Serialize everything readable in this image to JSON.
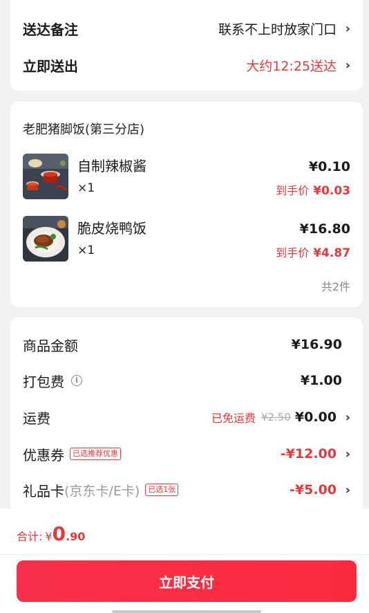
{
  "delivery": {
    "note_label": "送达备注",
    "note_value": "联系不上时放家门口",
    "time_label": "立即送出",
    "time_value": "大约12:25送达"
  },
  "order": {
    "store_name": "老肥猪脚饭(第三分店)",
    "items": [
      {
        "name": "自制辣椒酱",
        "qty": "×1",
        "price": "¥0.10",
        "final_label": "到手价",
        "final_price": "¥0.03",
        "image": "chili-sauce"
      },
      {
        "name": "脆皮烧鸭饭",
        "qty": "×1",
        "price": "¥16.80",
        "final_label": "到手价",
        "final_price": "¥4.87",
        "image": "roast-duck-rice"
      }
    ],
    "count": "共2件"
  },
  "summary": {
    "goods_label": "商品金额",
    "goods_value": "¥16.90",
    "packing_label": "打包费",
    "packing_value": "¥1.00",
    "shipping_label": "运费",
    "shipping_free": "已免运费",
    "shipping_original": "¥2.50",
    "shipping_value": "¥0.00",
    "coupon_label": "优惠券",
    "coupon_tag": "已选推荐优惠",
    "coupon_value": "-¥12.00",
    "giftcard_label": "礼品卡",
    "giftcard_sub": "(京东卡/E卡)",
    "giftcard_tag": "已选1张",
    "giftcard_value": "-¥5.00"
  },
  "footer": {
    "total_label": "合计:",
    "currency": "¥",
    "total_int": "0",
    "total_dec": ".90",
    "pay_label": "立即支付"
  },
  "colors": {
    "accent": "#e4393c",
    "pay_button": "#f9304b",
    "background": "#f2f2f2"
  }
}
